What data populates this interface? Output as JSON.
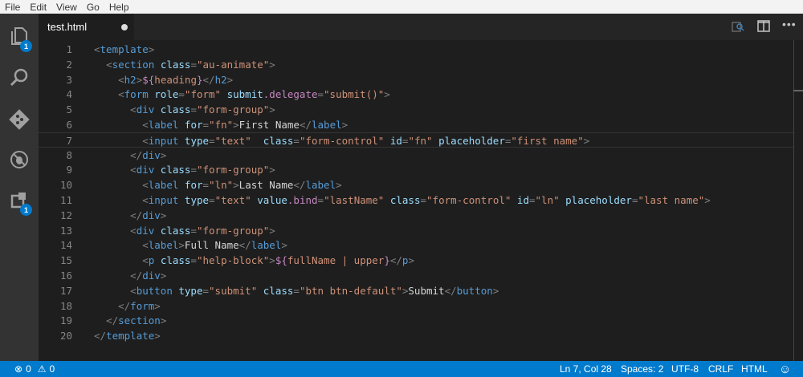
{
  "menu": [
    "File",
    "Edit",
    "View",
    "Go",
    "Help"
  ],
  "tab": {
    "title": "test.html"
  },
  "badges": {
    "explorer": "1",
    "extensions": "1"
  },
  "lines": [
    [
      [
        "p",
        "<"
      ],
      [
        "t",
        "template"
      ],
      [
        "p",
        ">"
      ]
    ],
    [
      [
        "x",
        "  "
      ],
      [
        "p",
        "<"
      ],
      [
        "t",
        "section"
      ],
      [
        "x",
        " "
      ],
      [
        "a",
        "class"
      ],
      [
        "p",
        "="
      ],
      [
        "s",
        "\"au-animate\""
      ],
      [
        "p",
        ">"
      ]
    ],
    [
      [
        "x",
        "    "
      ],
      [
        "p",
        "<"
      ],
      [
        "t",
        "h2"
      ],
      [
        "p",
        ">"
      ],
      [
        "m",
        "${"
      ],
      [
        "i",
        "heading"
      ],
      [
        "m",
        "}"
      ],
      [
        "p",
        "</"
      ],
      [
        "t",
        "h2"
      ],
      [
        "p",
        ">"
      ]
    ],
    [
      [
        "x",
        "    "
      ],
      [
        "p",
        "<"
      ],
      [
        "t",
        "form"
      ],
      [
        "x",
        " "
      ],
      [
        "a",
        "role"
      ],
      [
        "p",
        "="
      ],
      [
        "s",
        "\"form\""
      ],
      [
        "x",
        " "
      ],
      [
        "a",
        "submit"
      ],
      [
        "m",
        ".delegate"
      ],
      [
        "p",
        "="
      ],
      [
        "s",
        "\"submit()\""
      ],
      [
        "p",
        ">"
      ]
    ],
    [
      [
        "x",
        "      "
      ],
      [
        "p",
        "<"
      ],
      [
        "t",
        "div"
      ],
      [
        "x",
        " "
      ],
      [
        "a",
        "class"
      ],
      [
        "p",
        "="
      ],
      [
        "s",
        "\"form-group\""
      ],
      [
        "p",
        ">"
      ]
    ],
    [
      [
        "x",
        "        "
      ],
      [
        "p",
        "<"
      ],
      [
        "t",
        "label"
      ],
      [
        "x",
        " "
      ],
      [
        "a",
        "for"
      ],
      [
        "p",
        "="
      ],
      [
        "s",
        "\"fn\""
      ],
      [
        "p",
        ">"
      ],
      [
        "x",
        "First Name"
      ],
      [
        "p",
        "</"
      ],
      [
        "t",
        "label"
      ],
      [
        "p",
        ">"
      ]
    ],
    [
      [
        "x",
        "        "
      ],
      [
        "p",
        "<"
      ],
      [
        "t",
        "input"
      ],
      [
        "x",
        " "
      ],
      [
        "a",
        "type"
      ],
      [
        "p",
        "="
      ],
      [
        "s",
        "\"text\""
      ],
      [
        "x",
        "  "
      ],
      [
        "a",
        "class"
      ],
      [
        "p",
        "="
      ],
      [
        "s",
        "\"form-control\""
      ],
      [
        "x",
        " "
      ],
      [
        "a",
        "id"
      ],
      [
        "p",
        "="
      ],
      [
        "s",
        "\"fn\""
      ],
      [
        "x",
        " "
      ],
      [
        "a",
        "placeholder"
      ],
      [
        "p",
        "="
      ],
      [
        "s",
        "\"first name\""
      ],
      [
        "p",
        ">"
      ]
    ],
    [
      [
        "x",
        "      "
      ],
      [
        "p",
        "</"
      ],
      [
        "t",
        "div"
      ],
      [
        "p",
        ">"
      ]
    ],
    [
      [
        "x",
        "      "
      ],
      [
        "p",
        "<"
      ],
      [
        "t",
        "div"
      ],
      [
        "x",
        " "
      ],
      [
        "a",
        "class"
      ],
      [
        "p",
        "="
      ],
      [
        "s",
        "\"form-group\""
      ],
      [
        "p",
        ">"
      ]
    ],
    [
      [
        "x",
        "        "
      ],
      [
        "p",
        "<"
      ],
      [
        "t",
        "label"
      ],
      [
        "x",
        " "
      ],
      [
        "a",
        "for"
      ],
      [
        "p",
        "="
      ],
      [
        "s",
        "\"ln\""
      ],
      [
        "p",
        ">"
      ],
      [
        "x",
        "Last Name"
      ],
      [
        "p",
        "</"
      ],
      [
        "t",
        "label"
      ],
      [
        "p",
        ">"
      ]
    ],
    [
      [
        "x",
        "        "
      ],
      [
        "p",
        "<"
      ],
      [
        "t",
        "input"
      ],
      [
        "x",
        " "
      ],
      [
        "a",
        "type"
      ],
      [
        "p",
        "="
      ],
      [
        "s",
        "\"text\""
      ],
      [
        "x",
        " "
      ],
      [
        "a",
        "value"
      ],
      [
        "m",
        ".bind"
      ],
      [
        "p",
        "="
      ],
      [
        "s",
        "\"lastName\""
      ],
      [
        "x",
        " "
      ],
      [
        "a",
        "class"
      ],
      [
        "p",
        "="
      ],
      [
        "s",
        "\"form-control\""
      ],
      [
        "x",
        " "
      ],
      [
        "a",
        "id"
      ],
      [
        "p",
        "="
      ],
      [
        "s",
        "\"ln\""
      ],
      [
        "x",
        " "
      ],
      [
        "a",
        "placeholder"
      ],
      [
        "p",
        "="
      ],
      [
        "s",
        "\"last name\""
      ],
      [
        "p",
        ">"
      ]
    ],
    [
      [
        "x",
        "      "
      ],
      [
        "p",
        "</"
      ],
      [
        "t",
        "div"
      ],
      [
        "p",
        ">"
      ]
    ],
    [
      [
        "x",
        "      "
      ],
      [
        "p",
        "<"
      ],
      [
        "t",
        "div"
      ],
      [
        "x",
        " "
      ],
      [
        "a",
        "class"
      ],
      [
        "p",
        "="
      ],
      [
        "s",
        "\"form-group\""
      ],
      [
        "p",
        ">"
      ]
    ],
    [
      [
        "x",
        "        "
      ],
      [
        "p",
        "<"
      ],
      [
        "t",
        "label"
      ],
      [
        "p",
        ">"
      ],
      [
        "x",
        "Full Name"
      ],
      [
        "p",
        "</"
      ],
      [
        "t",
        "label"
      ],
      [
        "p",
        ">"
      ]
    ],
    [
      [
        "x",
        "        "
      ],
      [
        "p",
        "<"
      ],
      [
        "t",
        "p"
      ],
      [
        "x",
        " "
      ],
      [
        "a",
        "class"
      ],
      [
        "p",
        "="
      ],
      [
        "s",
        "\"help-block\""
      ],
      [
        "p",
        ">"
      ],
      [
        "m",
        "${"
      ],
      [
        "i",
        "fullName | upper"
      ],
      [
        "m",
        "}"
      ],
      [
        "p",
        "</"
      ],
      [
        "t",
        "p"
      ],
      [
        "p",
        ">"
      ]
    ],
    [
      [
        "x",
        "      "
      ],
      [
        "p",
        "</"
      ],
      [
        "t",
        "div"
      ],
      [
        "p",
        ">"
      ]
    ],
    [
      [
        "x",
        "      "
      ],
      [
        "p",
        "<"
      ],
      [
        "t",
        "button"
      ],
      [
        "x",
        " "
      ],
      [
        "a",
        "type"
      ],
      [
        "p",
        "="
      ],
      [
        "s",
        "\"submit\""
      ],
      [
        "x",
        " "
      ],
      [
        "a",
        "class"
      ],
      [
        "p",
        "="
      ],
      [
        "s",
        "\"btn btn-default\""
      ],
      [
        "p",
        ">"
      ],
      [
        "x",
        "Submit"
      ],
      [
        "p",
        "</"
      ],
      [
        "t",
        "button"
      ],
      [
        "p",
        ">"
      ]
    ],
    [
      [
        "x",
        "    "
      ],
      [
        "p",
        "</"
      ],
      [
        "t",
        "form"
      ],
      [
        "p",
        ">"
      ]
    ],
    [
      [
        "x",
        "  "
      ],
      [
        "p",
        "</"
      ],
      [
        "t",
        "section"
      ],
      [
        "p",
        ">"
      ]
    ],
    [
      [
        "p",
        "</"
      ],
      [
        "t",
        "template"
      ],
      [
        "p",
        ">"
      ]
    ]
  ],
  "current_line": 7,
  "status": {
    "errors": "0",
    "warnings": "0",
    "position": "Ln 7, Col 28",
    "spaces": "Spaces: 2",
    "encoding": "UTF-8",
    "eol": "CRLF",
    "language": "HTML",
    "feedback": "☺"
  }
}
